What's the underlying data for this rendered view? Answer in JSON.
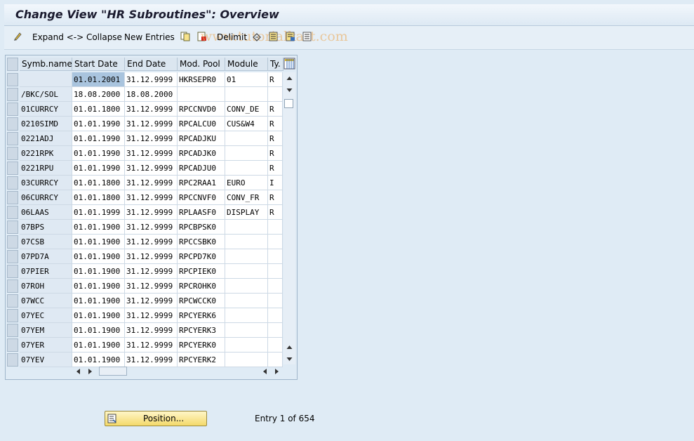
{
  "title": "Change View \"HR Subroutines\": Overview",
  "toolbar": {
    "expand_collapse": "Expand <-> Collapse",
    "new_entries": "New Entries",
    "delimit": "Delimit",
    "watermark": "www.tutorialkart.com"
  },
  "table": {
    "headers": [
      "Symb.name",
      "Start Date",
      "End Date",
      "Mod. Pool",
      "Module",
      "Ty."
    ],
    "rows": [
      [
        "",
        "01.01.2001",
        "31.12.9999",
        "HKRSEPR0",
        "01",
        "R"
      ],
      [
        "/BKC/SOL",
        "18.08.2000",
        "18.08.2000",
        "",
        "",
        ""
      ],
      [
        "01CURRCY",
        "01.01.1800",
        "31.12.9999",
        "RPCCNVD0",
        "CONV_DE",
        "R"
      ],
      [
        "0210SIMD",
        "01.01.1990",
        "31.12.9999",
        "RPCALCU0",
        "CUS&W4",
        "R"
      ],
      [
        "0221ADJ",
        "01.01.1990",
        "31.12.9999",
        "RPCADJKU",
        "",
        "R"
      ],
      [
        "0221RPK",
        "01.01.1990",
        "31.12.9999",
        "RPCADJK0",
        "",
        "R"
      ],
      [
        "0221RPU",
        "01.01.1990",
        "31.12.9999",
        "RPCADJU0",
        "",
        "R"
      ],
      [
        "03CURRCY",
        "01.01.1800",
        "31.12.9999",
        "RPC2RAA1",
        "EURO",
        "I"
      ],
      [
        "06CURRCY",
        "01.01.1800",
        "31.12.9999",
        "RPCCNVF0",
        "CONV_FR",
        "R"
      ],
      [
        "06LAAS",
        "01.01.1999",
        "31.12.9999",
        "RPLAASF0",
        "DISPLAY",
        "R"
      ],
      [
        "07BPS",
        "01.01.1900",
        "31.12.9999",
        "RPCBPSK0",
        "",
        ""
      ],
      [
        "07CSB",
        "01.01.1900",
        "31.12.9999",
        "RPCCSBK0",
        "",
        ""
      ],
      [
        "07PD7A",
        "01.01.1900",
        "31.12.9999",
        "RPCPD7K0",
        "",
        ""
      ],
      [
        "07PIER",
        "01.01.1900",
        "31.12.9999",
        "RPCPIEK0",
        "",
        ""
      ],
      [
        "07ROH",
        "01.01.1900",
        "31.12.9999",
        "RPCROHK0",
        "",
        ""
      ],
      [
        "07WCC",
        "01.01.1900",
        "31.12.9999",
        "RPCWCCK0",
        "",
        ""
      ],
      [
        "07YEC",
        "01.01.1900",
        "31.12.9999",
        "RPCYERK6",
        "",
        ""
      ],
      [
        "07YEM",
        "01.01.1900",
        "31.12.9999",
        "RPCYERK3",
        "",
        ""
      ],
      [
        "07YER",
        "01.01.1900",
        "31.12.9999",
        "RPCYERK0",
        "",
        ""
      ],
      [
        "07YEV",
        "01.01.1900",
        "31.12.9999",
        "RPCYERK2",
        "",
        ""
      ]
    ]
  },
  "position_button": "Position...",
  "entry_info": "Entry 1 of 654",
  "colors": {
    "background": "#dfebf5",
    "button": "#f4d96a",
    "selected_cell": "#a9c4de"
  }
}
